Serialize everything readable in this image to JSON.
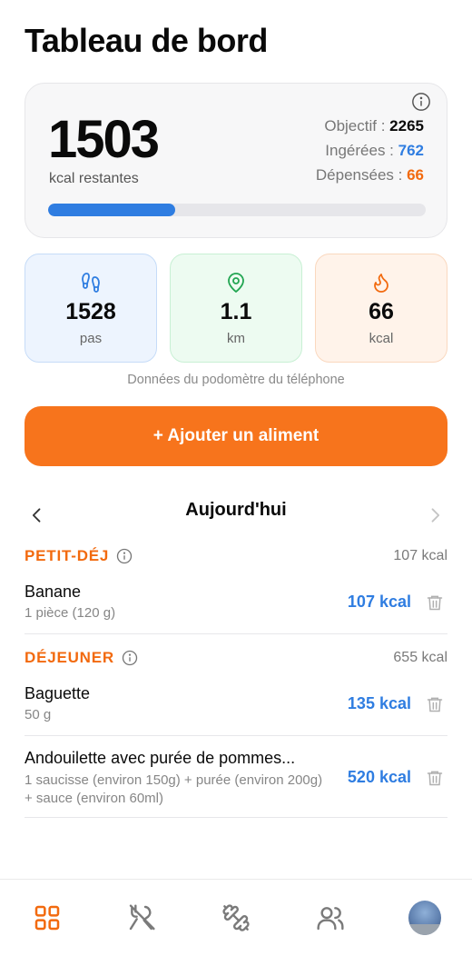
{
  "header": {
    "title": "Tableau de bord"
  },
  "summary": {
    "remaining_value": "1503",
    "remaining_label": "kcal restantes",
    "objective_label": "Objectif :",
    "objective_value": "2265",
    "ingested_label": "Ingérées :",
    "ingested_value": "762",
    "burned_label": "Dépensées :",
    "burned_value": "66",
    "progress_fraction": 0.336,
    "colors": {
      "ingested": "#2f7de1",
      "burned": "#f26a0f"
    }
  },
  "tiles": [
    {
      "icon": "footsteps-icon",
      "value": "1528",
      "label": "pas",
      "color": "#2f7de1"
    },
    {
      "icon": "location-pin-icon",
      "value": "1.1",
      "label": "km",
      "color": "#22a552"
    },
    {
      "icon": "flame-icon",
      "value": "66",
      "label": "kcal",
      "color": "#f26a0f"
    }
  ],
  "pedometer_note": "Données du podomètre du téléphone",
  "add_button_label": "+ Ajouter un aliment",
  "date_nav": {
    "label": "Aujourd'hui",
    "prev_icon": "chevron-left-icon",
    "next_icon": "chevron-right-icon"
  },
  "meals": [
    {
      "title": "PETIT-DÉJ",
      "total": "107 kcal",
      "items": [
        {
          "name": "Banane",
          "qty": "1 pièce (120 g)",
          "kcal": "107 kcal"
        }
      ]
    },
    {
      "title": "DÉJEUNER",
      "total": "655 kcal",
      "items": [
        {
          "name": "Baguette",
          "qty": "50 g",
          "kcal": "135 kcal"
        },
        {
          "name": "Andouilette avec purée de pommes...",
          "qty": "1 saucisse (environ 150g) + purée (environ 200g) + sauce (environ 60ml)",
          "kcal": "520 kcal"
        }
      ]
    }
  ],
  "tab_bar": {
    "tabs": [
      "dashboard-icon",
      "utensils-off-icon",
      "dumbbell-icon",
      "users-icon",
      "profile-avatar"
    ],
    "active_color": "#f26a0f"
  }
}
